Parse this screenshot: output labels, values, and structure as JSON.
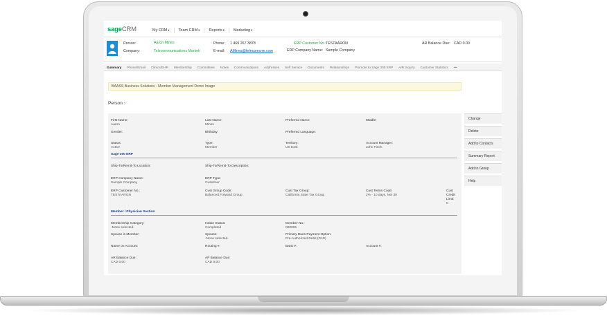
{
  "app": {
    "logo_brand": "sage",
    "logo_product": "CRM",
    "nav": [
      {
        "label": "My CRM"
      },
      {
        "label": "Team CRM"
      },
      {
        "label": "Reports"
      },
      {
        "label": "Marketing"
      }
    ]
  },
  "header": {
    "person_label": "Person:",
    "person_value": "Aaron Mines",
    "company_label": "Company:",
    "company_value": "Telecommunications Marketi",
    "phone_label": "Phone:",
    "phone_value": "1 469 267 3878",
    "email_label": "E-mail:",
    "email_value": "AMines@telecomcrm.com",
    "erp_customer_label": "ERP Customer No.:",
    "erp_customer_value": "TESTAARON",
    "erp_company_label": "ERP Company Name:",
    "erp_company_value": "Sample Company",
    "ar_balance_label": "AR Balance Due:",
    "ar_balance_value": "CAD 0.00"
  },
  "tabs": [
    {
      "label": "Summary",
      "active": true
    },
    {
      "label": "Phone/Email"
    },
    {
      "label": "Clinics/EHR"
    },
    {
      "label": "Membership"
    },
    {
      "label": "Committees"
    },
    {
      "label": "Notes"
    },
    {
      "label": "Communications"
    },
    {
      "label": "Addresses"
    },
    {
      "label": "Self Service"
    },
    {
      "label": "Documents"
    },
    {
      "label": "Relationships"
    },
    {
      "label": "Promote to Sage 300 ERP"
    },
    {
      "label": "A/R Inquiry"
    },
    {
      "label": "Customer Statistics"
    },
    {
      "label": "•••"
    }
  ],
  "banner": "BAASS Business Solutions - Member Management Demo Image",
  "section": {
    "title": "Person",
    "arrow": "›"
  },
  "fields": {
    "first_name_label": "First Name:",
    "first_name": "Aaron",
    "last_name_label": "Last Name:",
    "last_name": "Mines",
    "preferred_name_label": "Preferred Name:",
    "middle_label": "Middle:",
    "gender_label": "Gender:",
    "birthday_label": "Birthday:",
    "preferred_language_label": "Preferred Language:",
    "status_label": "Status:",
    "status": "Active",
    "type_label": "Type:",
    "type": "Member",
    "territory_label": "Territory:",
    "territory": "US East",
    "account_manager_label": "Account Manager:",
    "account_manager": "John Finch",
    "sage300_heading": "Sage 300 ERP",
    "ship_to_location_label": "Ship-To/Remit-To Location:",
    "ship_to_description_label": "Ship-To/Remit-To Description:",
    "erp_company_name_label": "ERP Company Name:",
    "erp_company_name": "Sample Company",
    "erp_type_label": "ERP Type:",
    "erp_type": "Customer",
    "erp_customer_no_label": "ERP Customer No.:",
    "erp_customer_no": "TESTAARON",
    "cust_group_label": "Cust Group Code:",
    "cust_group": "Balanced Forward Group",
    "cust_tax_group_label": "Cust Tax Group:",
    "cust_tax_group": "California State Tax Group",
    "cust_terms_label": "Cust Terms Code:",
    "cust_terms": "2% - 10 days, Net 30",
    "cust_credit_label_1": "Cust",
    "cust_credit_label_2": "Credit",
    "cust_credit_label_3": "Limit:",
    "cust_credit": "0",
    "member_heading": "Member / Physician Section",
    "membership_category_label": "Membership Category:",
    "membership_category": "-None selected-",
    "intake_status_label": "Intake Status:",
    "intake_status": "Completed",
    "member_no_label": "Member No.:",
    "member_no": "000005",
    "spouse_is_member_label": "Spouse is Member:",
    "spouse_label": "Spouse:",
    "spouse": "-None selected-",
    "primary_dues_label": "Primary Dues Payment Option:",
    "primary_dues": "Pre-Authorized Debit (PAD)",
    "name_on_account_label": "Name on Account:",
    "routing_label": "Routing #:",
    "bank_label": "Bank #:",
    "account_label": "Account #:",
    "ar_balance_label": "AR Balance Due:",
    "ar_balance": "CAD 0.00",
    "ap_balance_label": "AP Balance Due:",
    "ap_balance": "CAD 0.00"
  },
  "actions": [
    {
      "label": "Change"
    },
    {
      "label": "Delete"
    },
    {
      "label": "Add to Contacts"
    },
    {
      "label": "Summary Report"
    },
    {
      "label": "Add to Group"
    },
    {
      "label": "Help"
    }
  ],
  "colors": {
    "brand": "#00a651",
    "avatar": "#1a8fd8",
    "banner": "#fbf8df",
    "subhead": "#1b3f8f"
  }
}
